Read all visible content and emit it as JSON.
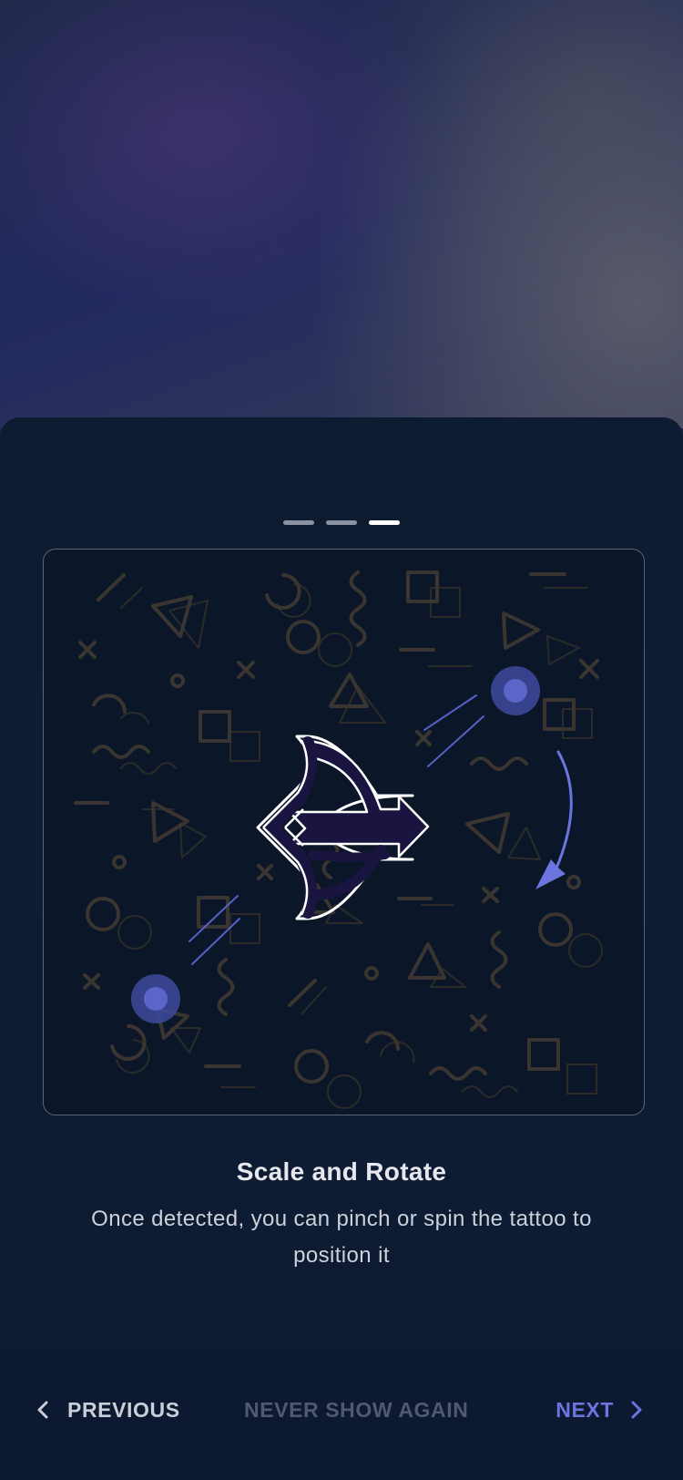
{
  "pager": {
    "total": 3,
    "active_index": 2
  },
  "slide": {
    "title": "Scale and Rotate",
    "description": "Once detected, you can pinch or spin the tattoo to position it",
    "illustration": {
      "icons": [
        "tattoo-symbol-icon",
        "rotate-arrow-icon",
        "touch-point-icon"
      ]
    }
  },
  "footer": {
    "previous_label": "PREVIOUS",
    "never_show_label": "NEVER SHOW AGAIN",
    "next_label": "NEXT"
  },
  "colors": {
    "accent": "#6b74df",
    "sheet_background": "#0e1d33",
    "card_border": "#5c6577",
    "pattern": "#3a3530",
    "pager_active": "#ffffff",
    "pager_inactive": "#8b93a3",
    "muted_text": "#4f5a70"
  }
}
